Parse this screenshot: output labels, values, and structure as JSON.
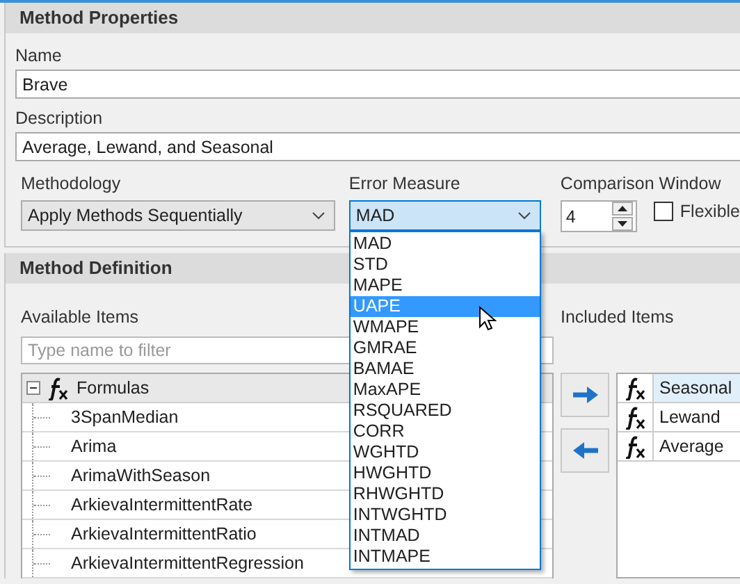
{
  "properties": {
    "title": "Method Properties",
    "name": {
      "label": "Name",
      "value": "Brave"
    },
    "description": {
      "label": "Description",
      "value": "Average, Lewand, and Seasonal"
    },
    "methodology": {
      "label": "Methodology",
      "value": "Apply Methods Sequentially"
    },
    "error_measure": {
      "label": "Error Measure",
      "value": "MAD",
      "open": true,
      "options": [
        {
          "label": "MAD",
          "highlighted": false
        },
        {
          "label": "STD",
          "highlighted": false
        },
        {
          "label": "MAPE",
          "highlighted": false
        },
        {
          "label": "UAPE",
          "highlighted": true
        },
        {
          "label": "WMAPE",
          "highlighted": false
        },
        {
          "label": "GMRAE",
          "highlighted": false
        },
        {
          "label": "BAMAE",
          "highlighted": false
        },
        {
          "label": "MaxAPE",
          "highlighted": false
        },
        {
          "label": "RSQUARED",
          "highlighted": false
        },
        {
          "label": "CORR",
          "highlighted": false
        },
        {
          "label": "WGHTD",
          "highlighted": false
        },
        {
          "label": "HWGHTD",
          "highlighted": false
        },
        {
          "label": "RHWGHTD",
          "highlighted": false
        },
        {
          "label": "INTWGHTD",
          "highlighted": false
        },
        {
          "label": "INTMAD",
          "highlighted": false
        },
        {
          "label": "INTMAPE",
          "highlighted": false
        }
      ]
    },
    "comparison_window": {
      "label": "Comparison Window",
      "value": "4"
    },
    "flexible": {
      "label": "Flexible",
      "checked": false
    }
  },
  "definition": {
    "title": "Method Definition",
    "available": {
      "label": "Available Items",
      "filter_placeholder": "Type name to filter",
      "tree": [
        {
          "label": "Formulas",
          "expanded": true,
          "children": [
            {
              "label": "3SpanMedian"
            },
            {
              "label": "Arima"
            },
            {
              "label": "ArimaWithSeason"
            },
            {
              "label": "ArkievaIntermittentRate"
            },
            {
              "label": "ArkievaIntermittentRatio"
            },
            {
              "label": "ArkievaIntermittentRegression"
            }
          ]
        }
      ]
    },
    "included": {
      "label": "Included Items",
      "rows": [
        {
          "label": "Seasonal",
          "selected": true
        },
        {
          "label": "Lewand",
          "selected": false
        },
        {
          "label": "Average",
          "selected": false
        }
      ]
    }
  }
}
